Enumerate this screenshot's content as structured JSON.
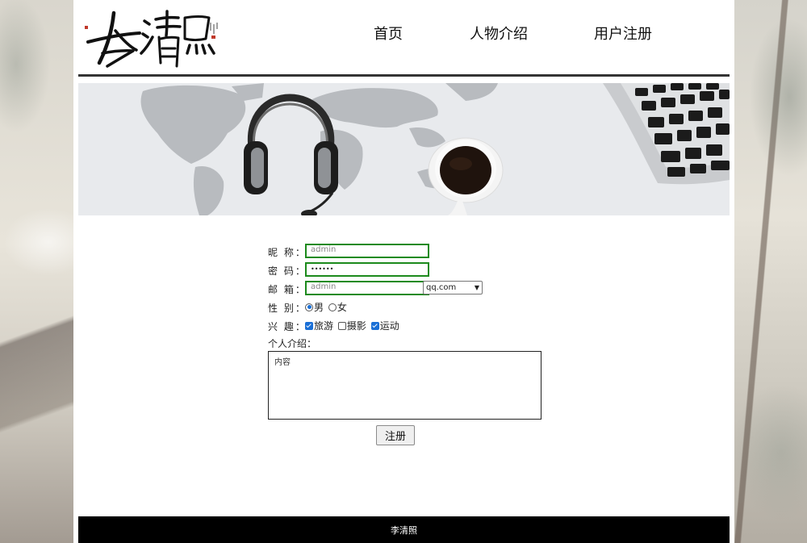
{
  "site": {
    "logo_text": "李清照"
  },
  "nav": [
    {
      "label": "首页"
    },
    {
      "label": "人物介绍"
    },
    {
      "label": "用户注册"
    }
  ],
  "form": {
    "nickname": {
      "label": "昵 称：",
      "value": "admin"
    },
    "password": {
      "label": "密 码：",
      "value": "••••••"
    },
    "email": {
      "label": "邮 箱：",
      "value": "admin",
      "domain_selected": "qq.com"
    },
    "gender": {
      "label": "性 别：",
      "options": [
        {
          "label": "男",
          "checked": true
        },
        {
          "label": "女",
          "checked": false
        }
      ]
    },
    "hobbies": {
      "label": "兴 趣：",
      "options": [
        {
          "label": "旅游",
          "checked": true
        },
        {
          "label": "摄影",
          "checked": false
        },
        {
          "label": "运动",
          "checked": true
        }
      ]
    },
    "intro": {
      "label": "个人介绍：",
      "value": "内容"
    },
    "submit_label": "注册"
  },
  "footer": {
    "text": "李清照"
  },
  "colors": {
    "input_border": "#1c8a1c",
    "footer_bg": "#000000",
    "header_line": "#333333",
    "accent": "#1a6fd6"
  }
}
